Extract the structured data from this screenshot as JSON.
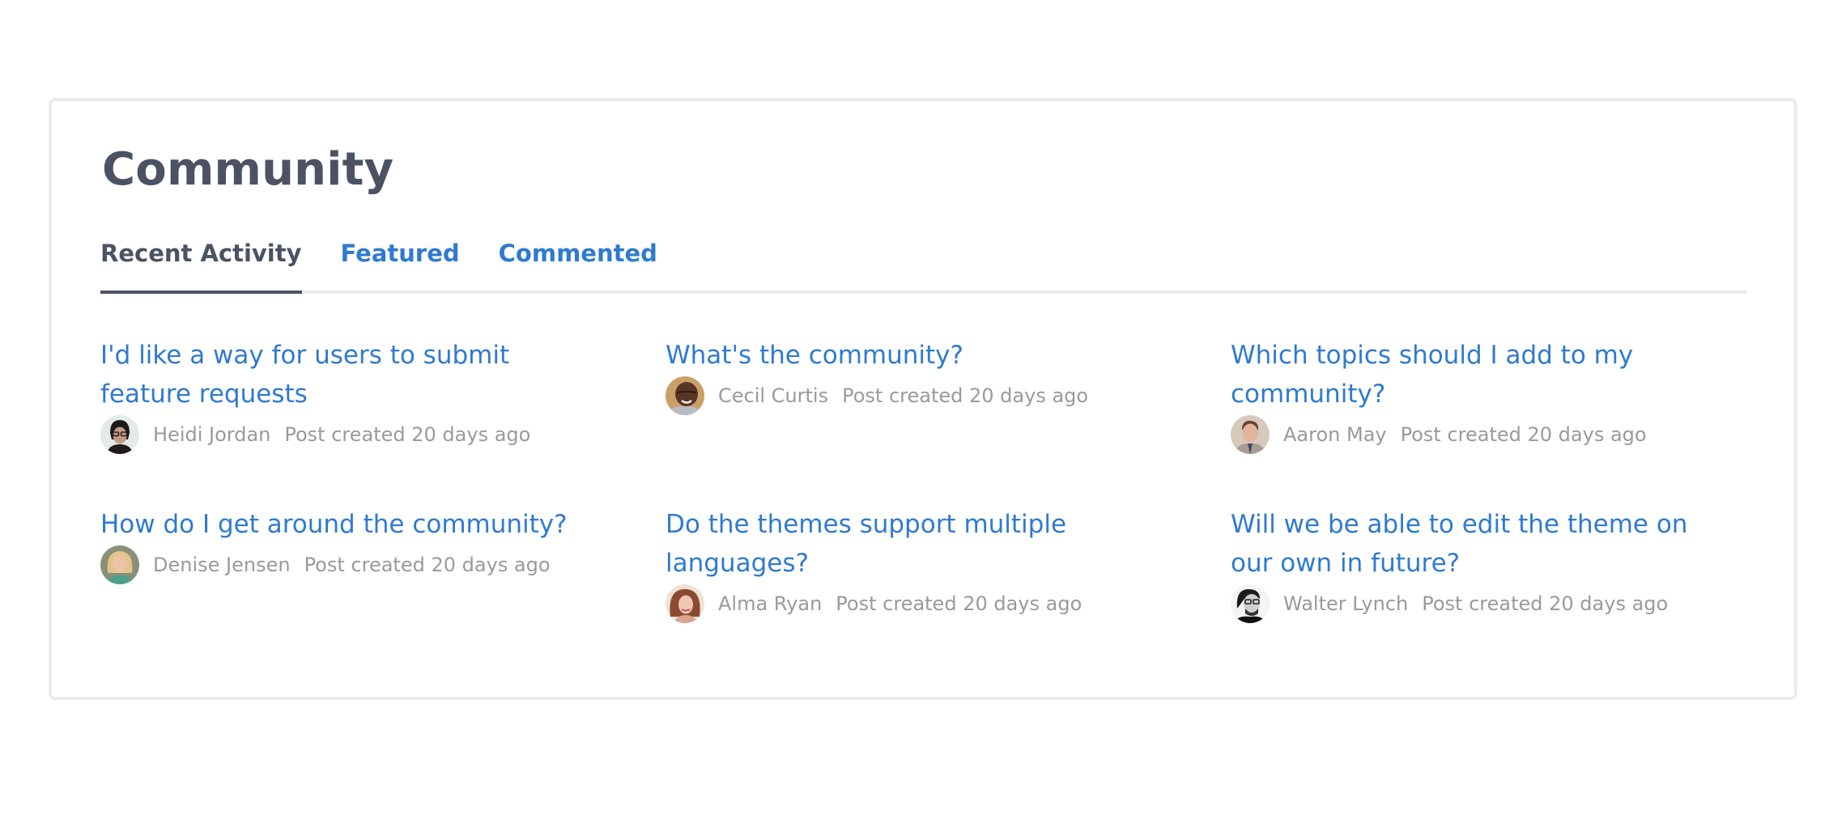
{
  "widget": {
    "title": "Community",
    "tabs": [
      {
        "label": "Recent Activity",
        "active": true
      },
      {
        "label": "Featured",
        "active": false
      },
      {
        "label": "Commented",
        "active": false
      }
    ]
  },
  "posts": [
    {
      "title": "I'd like a way for users to submit feature requests",
      "author": "Heidi Jordan",
      "timestamp": "Post created 20 days ago",
      "avatar_icon": "avatar-heidi-jordan"
    },
    {
      "title": "What's the community?",
      "author": "Cecil Curtis",
      "timestamp": "Post created 20 days ago",
      "avatar_icon": "avatar-cecil-curtis"
    },
    {
      "title": "Which topics should I add to my community?",
      "author": "Aaron May",
      "timestamp": "Post created 20 days ago",
      "avatar_icon": "avatar-aaron-may"
    },
    {
      "title": "How do I get around the community?",
      "author": "Denise Jensen",
      "timestamp": "Post created 20 days ago",
      "avatar_icon": "avatar-denise-jensen"
    },
    {
      "title": "Do the themes support multiple languages?",
      "author": "Alma Ryan",
      "timestamp": "Post created 20 days ago",
      "avatar_icon": "avatar-alma-ryan"
    },
    {
      "title": "Will we be able to edit the theme on our own in future?",
      "author": "Walter Lynch",
      "timestamp": "Post created 20 days ago",
      "avatar_icon": "avatar-walter-lynch"
    }
  ],
  "colors": {
    "link": "#2f7ad0",
    "heading": "#4b5264",
    "meta": "#9a9a9a",
    "border": "#ebecee"
  }
}
